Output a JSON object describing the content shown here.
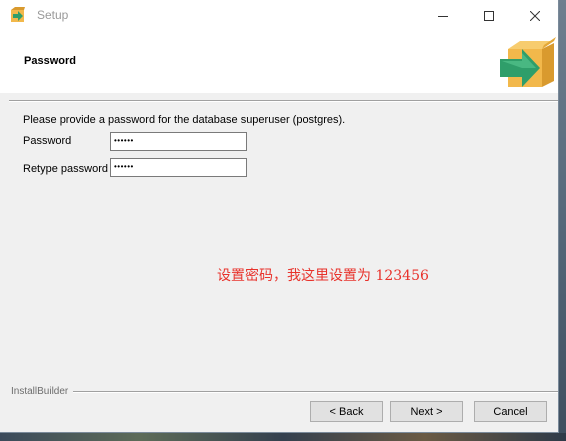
{
  "window": {
    "title": "Setup",
    "controls": {
      "minimize": "minimize-icon",
      "maximize": "maximize-icon",
      "close": "close-icon"
    }
  },
  "header": {
    "page_title": "Password",
    "logo_icon": "installer-box-arrow-icon"
  },
  "form": {
    "instruction": "Please provide a password for the database superuser (postgres).",
    "password": {
      "label": "Password",
      "value": "••••••"
    },
    "retype_password": {
      "label": "Retype password",
      "value": "••••••"
    }
  },
  "annotation": "设置密码，我这里设置为 123456",
  "footer": {
    "brand": "InstallBuilder",
    "back_label": "< Back",
    "next_label": "Next >",
    "cancel_label": "Cancel"
  },
  "colors": {
    "annotation": "#e8322b",
    "window_bg": "#f0f0f0",
    "logo_green": "#3aa876",
    "logo_box": "#f2b84b"
  }
}
